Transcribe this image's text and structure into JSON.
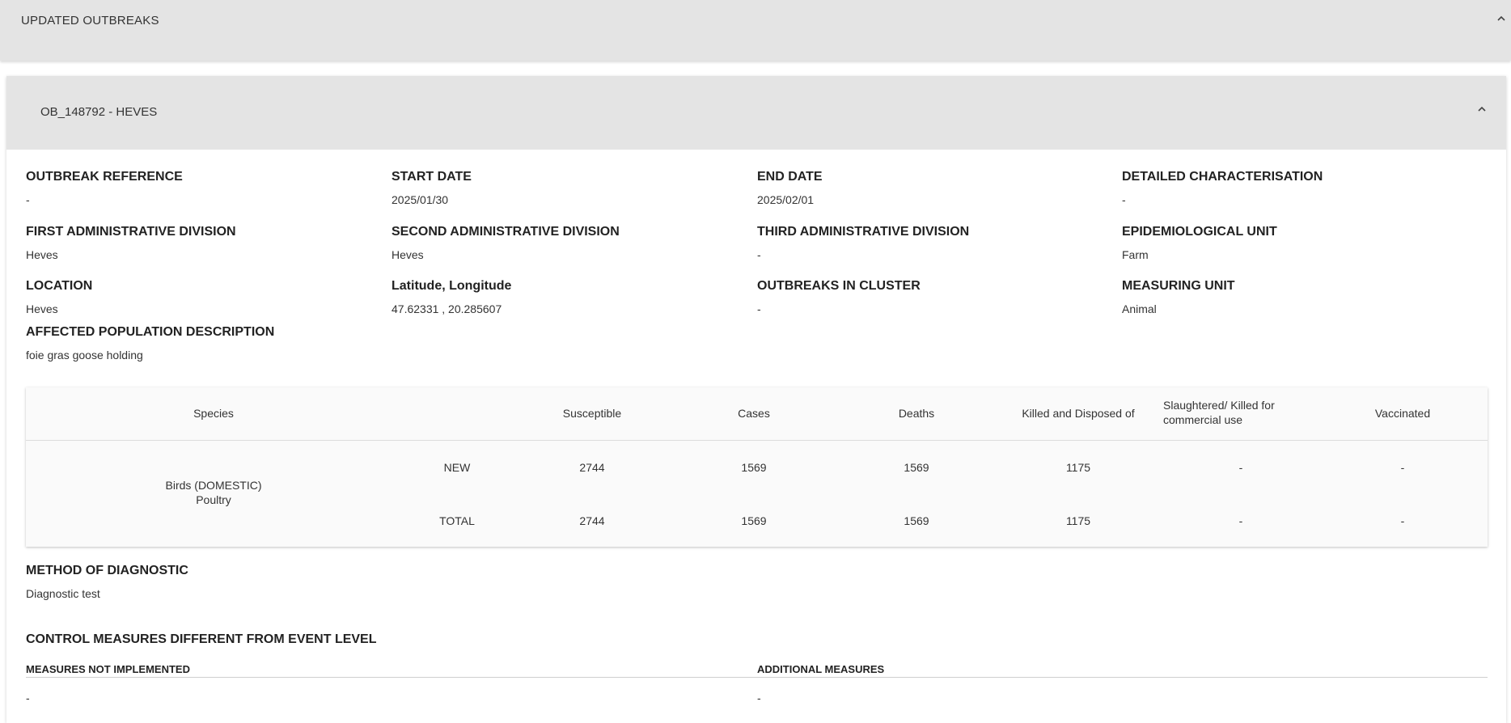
{
  "top_panel": {
    "title": "UPDATED OUTBREAKS"
  },
  "outbreak": {
    "header": "OB_148792 - HEVES",
    "fields": {
      "outbreak_reference": {
        "label": "OUTBREAK REFERENCE",
        "value": "-"
      },
      "start_date": {
        "label": "START DATE",
        "value": "2025/01/30"
      },
      "end_date": {
        "label": "END DATE",
        "value": "2025/02/01"
      },
      "detailed_characterisation": {
        "label": "DETAILED CHARACTERISATION",
        "value": "-"
      },
      "first_admin_division": {
        "label": "FIRST ADMINISTRATIVE DIVISION",
        "value": "Heves"
      },
      "second_admin_division": {
        "label": "SECOND ADMINISTRATIVE DIVISION",
        "value": "Heves"
      },
      "third_admin_division": {
        "label": "THIRD ADMINISTRATIVE DIVISION",
        "value": "-"
      },
      "epidemiological_unit": {
        "label": "EPIDEMIOLOGICAL UNIT",
        "value": "Farm"
      },
      "location": {
        "label": "LOCATION",
        "value": "Heves"
      },
      "lat_long": {
        "label": "Latitude, Longitude",
        "value": "47.62331 , 20.285607"
      },
      "outbreaks_in_cluster": {
        "label": "OUTBREAKS IN CLUSTER",
        "value": "-"
      },
      "measuring_unit": {
        "label": "MEASURING UNIT",
        "value": "Animal"
      },
      "affected_population": {
        "label": "AFFECTED POPULATION DESCRIPTION",
        "value": "foie gras goose holding"
      }
    },
    "table": {
      "headers": {
        "species": "Species",
        "susceptible": "Susceptible",
        "cases": "Cases",
        "deaths": "Deaths",
        "killed": "Killed and Disposed of",
        "slaughtered": "Slaughtered/ Killed for commercial use",
        "vaccinated": "Vaccinated"
      },
      "species_line1": "Birds (DOMESTIC)",
      "species_line2": "Poultry",
      "rows": [
        {
          "type": "NEW",
          "susceptible": "2744",
          "cases": "1569",
          "deaths": "1569",
          "killed": "1175",
          "slaughtered": "-",
          "vaccinated": "-"
        },
        {
          "type": "TOTAL",
          "susceptible": "2744",
          "cases": "1569",
          "deaths": "1569",
          "killed": "1175",
          "slaughtered": "-",
          "vaccinated": "-"
        }
      ]
    },
    "diagnostic": {
      "label": "METHOD OF DIAGNOSTIC",
      "value": "Diagnostic test"
    },
    "control_measures": {
      "title": "CONTROL MEASURES DIFFERENT FROM EVENT LEVEL",
      "not_implemented_label": "MEASURES NOT IMPLEMENTED",
      "not_implemented_value": "-",
      "additional_label": "ADDITIONAL MEASURES",
      "additional_value": "-"
    }
  }
}
